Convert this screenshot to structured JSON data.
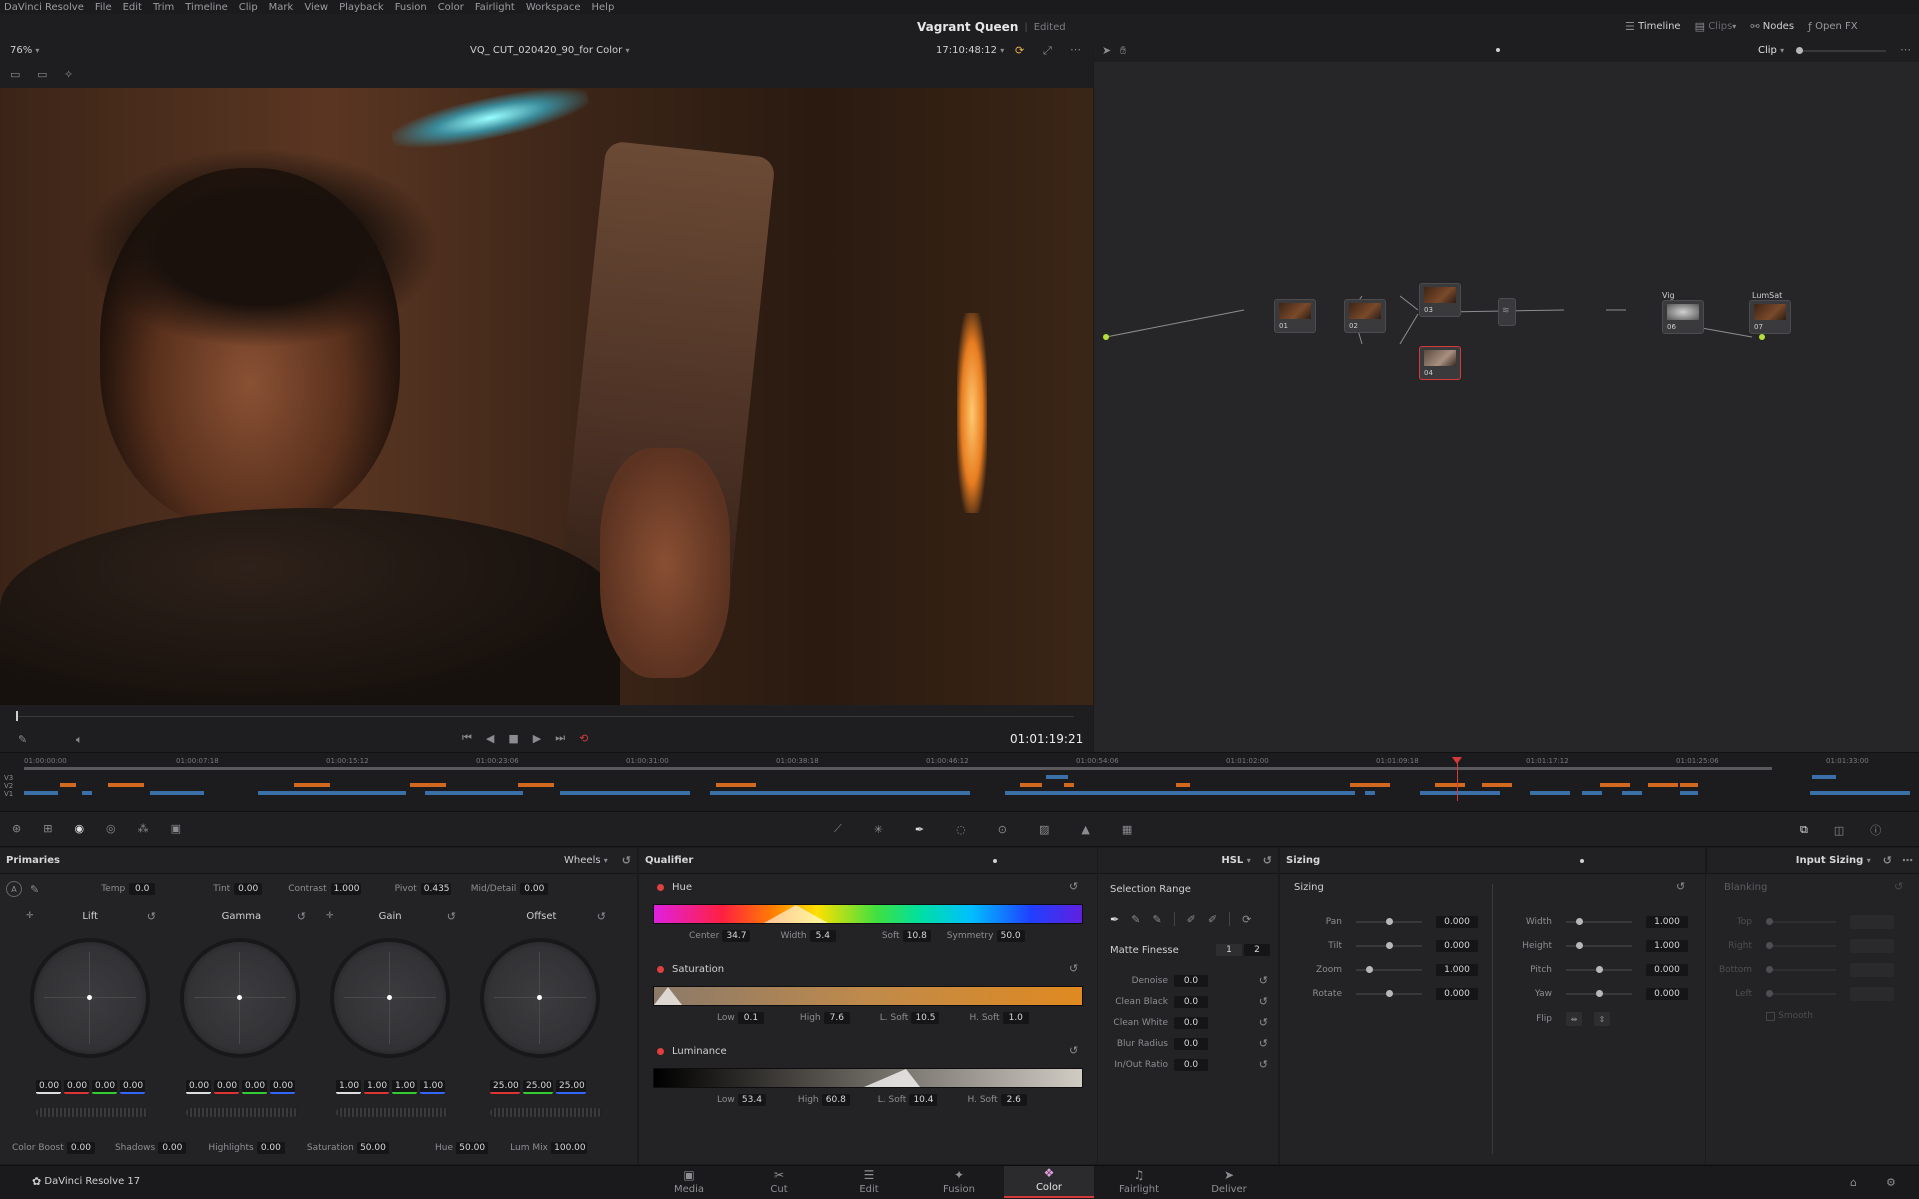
{
  "menu": [
    "DaVinci Resolve",
    "File",
    "Edit",
    "Trim",
    "Timeline",
    "Clip",
    "Mark",
    "View",
    "Playback",
    "Fusion",
    "Color",
    "Fairlight",
    "Workspace",
    "Help"
  ],
  "project": {
    "title": "Vagrant Queen",
    "status": "Edited"
  },
  "top_right": {
    "timeline": "Timeline",
    "clips": "Clips",
    "nodes": "Nodes",
    "openfx": "Open FX"
  },
  "viewer": {
    "zoom": "76%",
    "clip_name": "VQ_ CUT_020420_90_for Color",
    "timecode_top": "17:10:48:12",
    "timecode": "01:01:19:21"
  },
  "node_editor": {
    "mode": "Clip",
    "nodes": [
      {
        "id": "01",
        "label": ""
      },
      {
        "id": "02",
        "label": ""
      },
      {
        "id": "03",
        "label": ""
      },
      {
        "id": "04",
        "label": ""
      },
      {
        "id": "06",
        "label": "Vig"
      },
      {
        "id": "07",
        "label": "LumSat"
      }
    ]
  },
  "timeline": {
    "tracks": [
      "V3",
      "V2",
      "V1"
    ],
    "ticks": [
      "01:00:00:00",
      "01:00:07:18",
      "01:00:15:12",
      "01:00:23:06",
      "01:00:31:00",
      "01:00:38:18",
      "01:00:46:12",
      "01:00:54:06",
      "01:01:02:00",
      "01:01:09:18",
      "01:01:17:12",
      "01:01:25:06",
      "01:01:33:00"
    ],
    "playhead_fraction": 0.82
  },
  "primaries": {
    "title": "Primaries",
    "mode": "Wheels",
    "top": [
      {
        "label": "Temp",
        "value": "0.0"
      },
      {
        "label": "Tint",
        "value": "0.00"
      },
      {
        "label": "Contrast",
        "value": "1.000"
      },
      {
        "label": "Pivot",
        "value": "0.435"
      },
      {
        "label": "Mid/Detail",
        "value": "0.00"
      }
    ],
    "wheels": [
      {
        "name": "Lift",
        "values": [
          "0.00",
          "0.00",
          "0.00",
          "0.00"
        ]
      },
      {
        "name": "Gamma",
        "values": [
          "0.00",
          "0.00",
          "0.00",
          "0.00"
        ]
      },
      {
        "name": "Gain",
        "values": [
          "1.00",
          "1.00",
          "1.00",
          "1.00"
        ]
      },
      {
        "name": "Offset",
        "values": [
          "25.00",
          "25.00",
          "25.00"
        ]
      }
    ],
    "bottom": [
      {
        "label": "Color Boost",
        "value": "0.00"
      },
      {
        "label": "Shadows",
        "value": "0.00"
      },
      {
        "label": "Highlights",
        "value": "0.00"
      },
      {
        "label": "Saturation",
        "value": "50.00"
      },
      {
        "label": "Hue",
        "value": "50.00"
      },
      {
        "label": "Lum Mix",
        "value": "100.00"
      }
    ]
  },
  "qualifier": {
    "title": "Qualifier",
    "mode": "HSL",
    "hue": {
      "label": "Hue",
      "fields": [
        {
          "label": "Center",
          "value": "34.7"
        },
        {
          "label": "Width",
          "value": "5.4"
        },
        {
          "label": "Soft",
          "value": "10.8"
        },
        {
          "label": "Symmetry",
          "value": "50.0"
        }
      ]
    },
    "sat": {
      "label": "Saturation",
      "fields": [
        {
          "label": "Low",
          "value": "0.1"
        },
        {
          "label": "High",
          "value": "7.6"
        },
        {
          "label": "L. Soft",
          "value": "10.5"
        },
        {
          "label": "H. Soft",
          "value": "1.0"
        }
      ]
    },
    "lum": {
      "label": "Luminance",
      "fields": [
        {
          "label": "Low",
          "value": "53.4"
        },
        {
          "label": "High",
          "value": "60.8"
        },
        {
          "label": "L. Soft",
          "value": "10.4"
        },
        {
          "label": "H. Soft",
          "value": "2.6"
        }
      ]
    }
  },
  "selection": {
    "title": "Selection Range",
    "matte_title": "Matte Finesse",
    "tab1": "1",
    "tab2": "2",
    "rows": [
      {
        "label": "Denoise",
        "value": "0.0"
      },
      {
        "label": "Clean Black",
        "value": "0.0"
      },
      {
        "label": "Clean White",
        "value": "0.0"
      },
      {
        "label": "Blur Radius",
        "value": "0.0"
      },
      {
        "label": "In/Out Ratio",
        "value": "0.0"
      }
    ]
  },
  "sizing": {
    "title": "Sizing",
    "sub": "Sizing",
    "mode": "Input Sizing",
    "left": [
      {
        "label": "Pan",
        "value": "0.000"
      },
      {
        "label": "Tilt",
        "value": "0.000"
      },
      {
        "label": "Zoom",
        "value": "1.000"
      },
      {
        "label": "Rotate",
        "value": "0.000"
      }
    ],
    "right": [
      {
        "label": "Width",
        "value": "1.000"
      },
      {
        "label": "Height",
        "value": "1.000"
      },
      {
        "label": "Pitch",
        "value": "0.000"
      },
      {
        "label": "Yaw",
        "value": "0.000"
      }
    ],
    "flip": "Flip"
  },
  "blanking": {
    "title": "Blanking",
    "rows": [
      "Top",
      "Right",
      "Bottom",
      "Left"
    ],
    "smooth": "Smooth"
  },
  "pages": [
    {
      "label": "Media",
      "icon": "▣"
    },
    {
      "label": "Cut",
      "icon": "✂"
    },
    {
      "label": "Edit",
      "icon": "☰"
    },
    {
      "label": "Fusion",
      "icon": "✦"
    },
    {
      "label": "Color",
      "icon": "❖"
    },
    {
      "label": "Fairlight",
      "icon": "♫"
    },
    {
      "label": "Deliver",
      "icon": "➤"
    }
  ],
  "app": {
    "name": "DaVinci Resolve 17"
  },
  "colors": {
    "accent": "#d53a3a",
    "orange_clip": "#d2691e",
    "blue_clip": "#3b6fa8"
  }
}
